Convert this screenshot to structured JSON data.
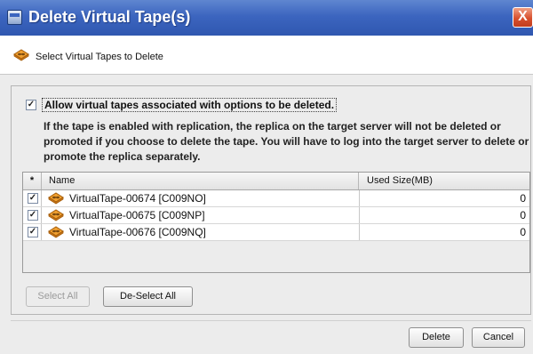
{
  "window": {
    "title": "Delete Virtual Tape(s)",
    "close_glyph": "X"
  },
  "header": {
    "text": "Select Virtual Tapes to Delete",
    "icon": "tape-icon"
  },
  "options": {
    "allow_label": "Allow virtual tapes associated with options to be deleted.",
    "allow_checked": true,
    "info_text": "If the tape is enabled with replication, the replica on the target server will not be deleted or promoted if you choose to delete the tape. You will have to log into the target server to delete or promote the replica separately."
  },
  "table": {
    "columns": [
      "*",
      "Name",
      "Used Size(MB)"
    ],
    "rows": [
      {
        "checked": true,
        "name": "VirtualTape-00674 [C009NO]",
        "size": "0"
      },
      {
        "checked": true,
        "name": "VirtualTape-00675 [C009NP]",
        "size": "0"
      },
      {
        "checked": true,
        "name": "VirtualTape-00676 [C009NQ]",
        "size": "0"
      }
    ]
  },
  "buttons": {
    "select_all": "Select All",
    "deselect_all": "De-Select All",
    "delete": "Delete",
    "cancel": "Cancel"
  },
  "check_glyph": "✓",
  "colors": {
    "titlebar": "#3c65bf",
    "close": "#d8502e",
    "tape_orange": "#f0a030"
  }
}
